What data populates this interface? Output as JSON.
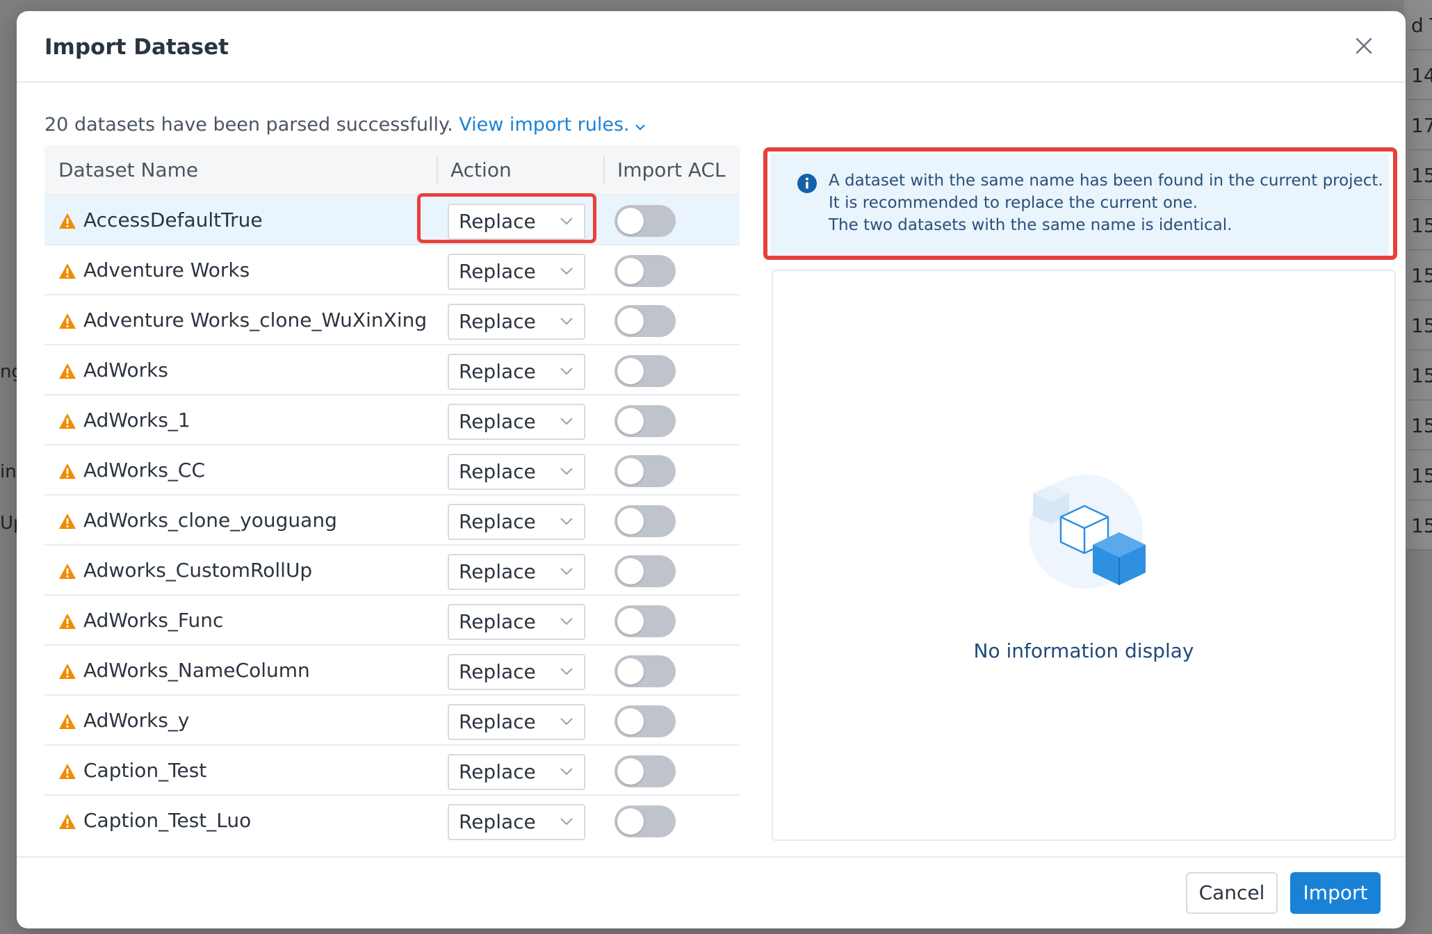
{
  "background": {
    "right_cells": [
      "d T",
      "14",
      "17",
      "15",
      "15",
      "15",
      "15",
      "15",
      "15",
      "15",
      "15"
    ],
    "left_fragments": [
      "ng",
      "in",
      "Up"
    ]
  },
  "dialog": {
    "title": "Import Dataset",
    "close_icon": "close-icon",
    "summary_text": "20 datasets have been parsed successfully. ",
    "rules_link": "View import rules.",
    "table": {
      "columns": [
        "Dataset Name",
        "Action",
        "Import ACL"
      ],
      "rows": [
        {
          "name": "AccessDefaultTrue",
          "action": "Replace",
          "acl": false,
          "selected": true
        },
        {
          "name": "Adventure Works",
          "action": "Replace",
          "acl": false
        },
        {
          "name": "Adventure Works_clone_WuXinXing",
          "action": "Replace",
          "acl": false
        },
        {
          "name": "AdWorks",
          "action": "Replace",
          "acl": false
        },
        {
          "name": "AdWorks_1",
          "action": "Replace",
          "acl": false
        },
        {
          "name": "AdWorks_CC",
          "action": "Replace",
          "acl": false
        },
        {
          "name": "AdWorks_clone_youguang",
          "action": "Replace",
          "acl": false
        },
        {
          "name": "Adworks_CustomRollUp",
          "action": "Replace",
          "acl": false
        },
        {
          "name": "AdWorks_Func",
          "action": "Replace",
          "acl": false
        },
        {
          "name": "AdWorks_NameColumn",
          "action": "Replace",
          "acl": false
        },
        {
          "name": "AdWorks_y",
          "action": "Replace",
          "acl": false
        },
        {
          "name": "Caption_Test",
          "action": "Replace",
          "acl": false
        },
        {
          "name": "Caption_Test_Luo",
          "action": "Replace",
          "acl": false
        }
      ]
    },
    "alert": {
      "lines": [
        "A dataset with the same name has been found in the current project.",
        "It is recommended to replace the current one.",
        "The two datasets with the same name is identical."
      ]
    },
    "empty_state": {
      "text": "No information display"
    },
    "footer": {
      "cancel_label": "Cancel",
      "import_label": "Import"
    }
  },
  "colors": {
    "accent": "#1a82d6",
    "highlight": "#e8413c",
    "warning": "#f08c00",
    "alert_bg": "#eaf4fc"
  }
}
